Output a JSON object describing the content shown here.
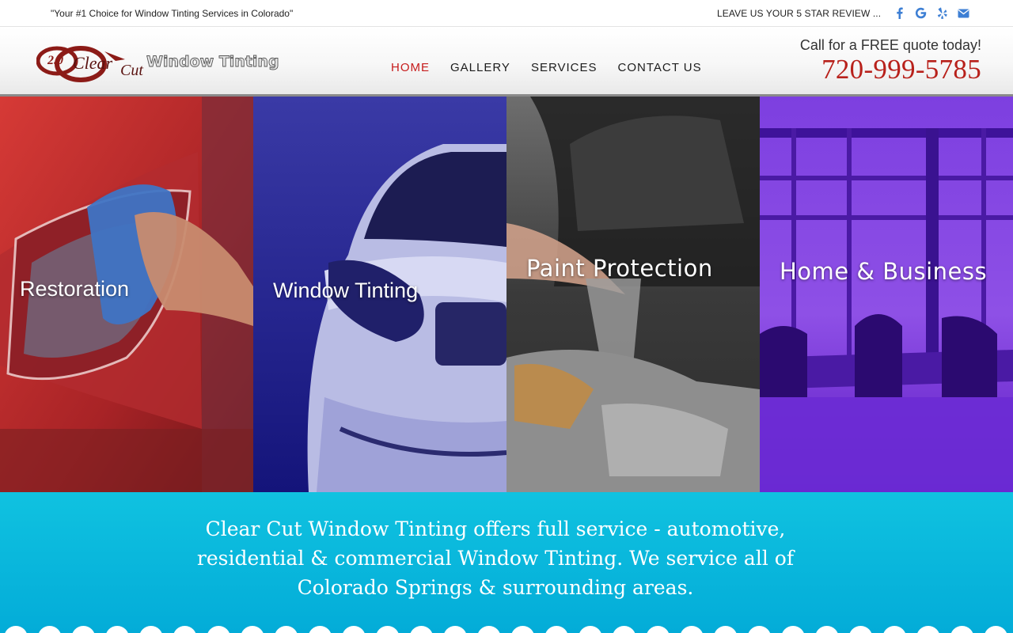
{
  "topbar": {
    "tagline": "\"Your #1 Choice for Window Tinting Services in Colorado\"",
    "review_link": "LEAVE US YOUR 5 STAR REVIEW ...",
    "social_icons": [
      "facebook-icon",
      "google-icon",
      "yelp-icon",
      "email-icon"
    ]
  },
  "header": {
    "logo_text_top": "2.0",
    "logo_text_clear": "Clear",
    "logo_text_cut": "Cut",
    "logo_text_tagline": "Window Tinting",
    "nav": [
      {
        "label": "HOME",
        "active": true
      },
      {
        "label": "GALLERY",
        "active": false
      },
      {
        "label": "SERVICES",
        "active": false
      },
      {
        "label": "CONTACT US",
        "active": false
      }
    ],
    "call_text": "Call for a FREE quote today!",
    "phone": "720-999-5785"
  },
  "panels": [
    {
      "label": "Restoration",
      "tint": "#c43a3a"
    },
    {
      "label": "Window Tinting",
      "tint": "#2b2c9e"
    },
    {
      "label": "Paint Protection",
      "tint": "#2a2a2a"
    },
    {
      "label": "Home & Business",
      "tint": "#6a2ad0"
    }
  ],
  "intro": {
    "text": "Clear Cut Window Tinting offers full service - automotive, residential & commercial Window Tinting. We service all of Colorado Springs & surrounding areas."
  },
  "colors": {
    "accent_red": "#c61c1c",
    "phone_red": "#b8211b",
    "social_blue": "#3d7fd4",
    "intro_cyan": "#06b4dc"
  }
}
